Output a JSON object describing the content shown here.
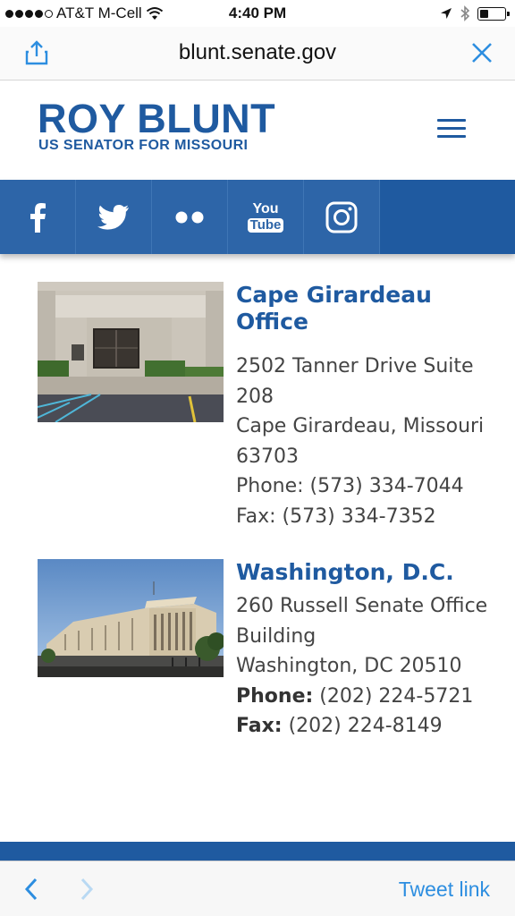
{
  "status_bar": {
    "carrier": "AT&T M-Cell",
    "time": "4:40 PM"
  },
  "browser": {
    "url": "blunt.senate.gov",
    "share_icon": "share-icon",
    "close_icon": "close-icon"
  },
  "site": {
    "name": "ROY BLUNT",
    "subtitle": "US SENATOR FOR MISSOURI",
    "menu_icon": "hamburger-menu-icon",
    "brand_color": "#1f5aa0"
  },
  "social": [
    {
      "name": "facebook-icon"
    },
    {
      "name": "twitter-icon"
    },
    {
      "name": "flickr-icon"
    },
    {
      "name": "youtube-icon",
      "label_top": "You",
      "label_bottom": "Tube"
    },
    {
      "name": "instagram-icon"
    }
  ],
  "offices": [
    {
      "title_line1": "Cape Girardeau",
      "title_line2": "Office",
      "address_line1": "2502 Tanner Drive Suite",
      "address_line2": "208",
      "city_line1": "Cape Girardeau, Missouri",
      "city_line2": "63703",
      "phone": "Phone: (573) 334-7044",
      "fax": "Fax: (573) 334-7352"
    },
    {
      "title": "Washington, D.C.",
      "address_line1": "260 Russell Senate Office",
      "address_line2": "Building",
      "city": "Washington, DC 20510",
      "phone_label": "Phone:",
      "phone_value": " (202) 224-5721",
      "fax_label": "Fax:",
      "fax_value": " (202) 224-8149"
    }
  ],
  "toolbar": {
    "tweet_label": "Tweet link",
    "link_color": "#2d8ee0"
  }
}
